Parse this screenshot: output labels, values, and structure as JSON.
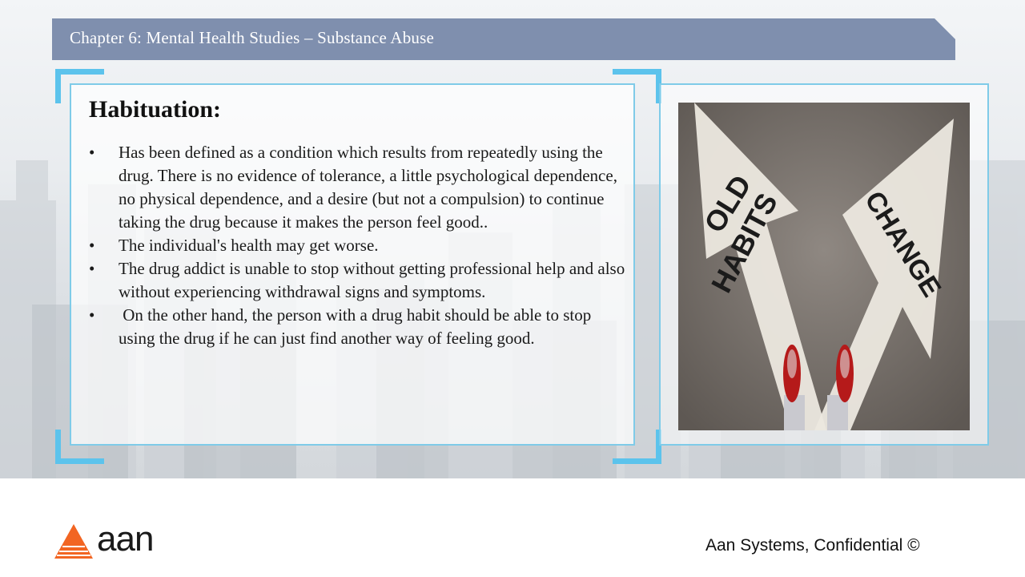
{
  "header": {
    "title": "Chapter 6: Mental Health Studies – Substance Abuse"
  },
  "content": {
    "heading": "Habituation:",
    "bullet_symbol": "•",
    "bullets": [
      "Has been defined as a condition which results from repeatedly using the drug.  There is no evidence of tolerance, a little psychological dependence, no physical dependence, and a desire (but not a compulsion) to continue taking the drug because it makes the person feel good..",
      "The individual's health may get worse.",
      "The drug addict is unable to stop without getting professional help and also without experiencing withdrawal signs and symptoms.",
      " On the other hand, the person with a drug habit should be able to stop using the drug if he can just find another way of feeling good."
    ]
  },
  "photo": {
    "left_arrow_text_line1": "OLD",
    "left_arrow_text_line2": "HABITS",
    "right_arrow_text": "CHANGE"
  },
  "footer": {
    "logo_text": "aan",
    "confidential": "Aan Systems, Confidential ©"
  },
  "colors": {
    "header_bg": "#7f8fae",
    "card_border": "#7fcbe8",
    "corner_accent": "#5cc3ec",
    "logo_orange": "#f26522"
  }
}
